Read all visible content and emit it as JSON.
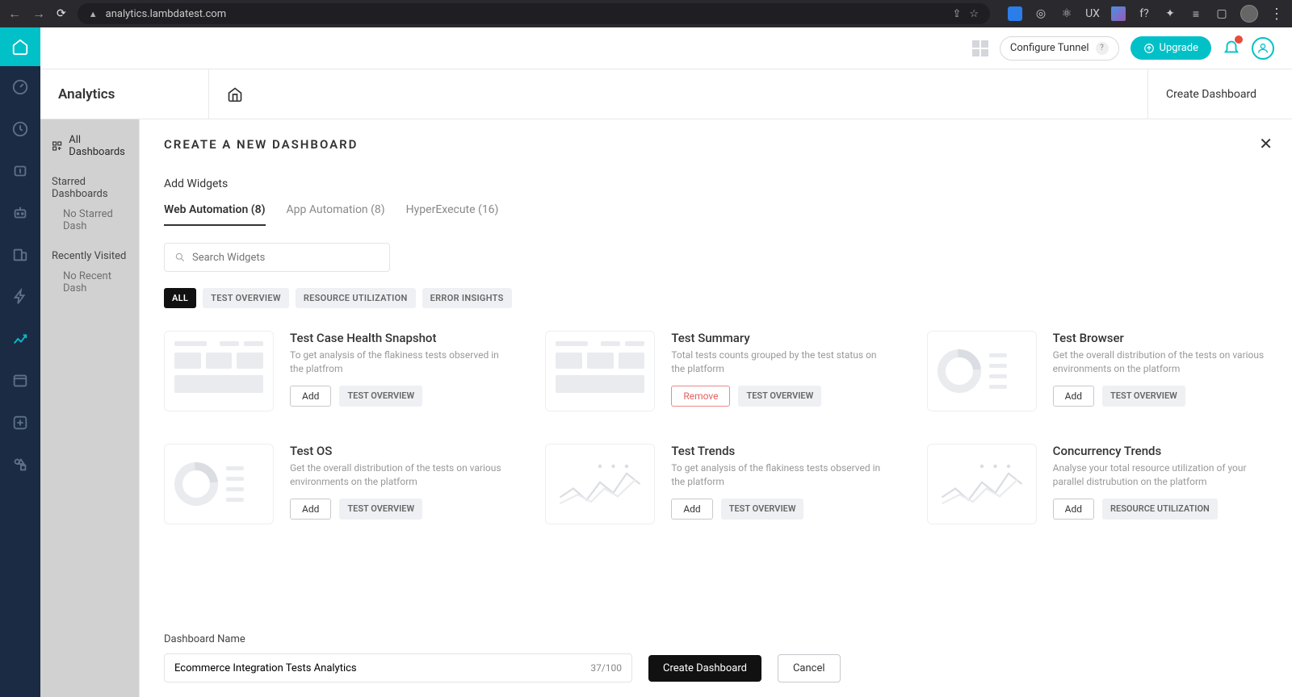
{
  "browser": {
    "url": "analytics.lambdatest.com"
  },
  "header": {
    "tunnel_label": "Configure Tunnel",
    "upgrade_label": "Upgrade"
  },
  "subheader": {
    "title": "Analytics",
    "create_link": "Create Dashboard"
  },
  "sidebar": {
    "all_dashboards": "All Dashboards",
    "starred_heading": "Starred Dashboards",
    "starred_empty": "No Starred Dash",
    "recent_heading": "Recently Visited",
    "recent_empty": "No Recent Dash"
  },
  "panel": {
    "title": "CREATE A NEW DASHBOARD",
    "add_widgets_label": "Add Widgets",
    "tabs": [
      {
        "label": "Web Automation (8)",
        "active": true
      },
      {
        "label": "App Automation (8)",
        "active": false
      },
      {
        "label": "HyperExecute (16)",
        "active": false
      }
    ],
    "search_placeholder": "Search Widgets",
    "filters": [
      {
        "label": "ALL",
        "active": true
      },
      {
        "label": "TEST OVERVIEW",
        "active": false
      },
      {
        "label": "RESOURCE UTILIZATION",
        "active": false
      },
      {
        "label": "ERROR INSIGHTS",
        "active": false
      }
    ],
    "widgets": [
      {
        "title": "Test Case Health Snapshot",
        "desc": "To get analysis of the flakiness tests observed in the platfrom",
        "action": "Add",
        "tag": "TEST OVERVIEW",
        "thumb": "skeleton"
      },
      {
        "title": "Test Summary",
        "desc": "Total tests counts grouped by the test status on the platform",
        "action": "Remove",
        "tag": "TEST OVERVIEW",
        "thumb": "skeleton"
      },
      {
        "title": "Test Browser",
        "desc": "Get the overall distribution of the tests on various environments on the platform",
        "action": "Add",
        "tag": "TEST OVERVIEW",
        "thumb": "donut"
      },
      {
        "title": "Test OS",
        "desc": "Get the overall distribution of the tests on various environments on the platform",
        "action": "Add",
        "tag": "TEST OVERVIEW",
        "thumb": "donut"
      },
      {
        "title": "Test Trends",
        "desc": "To get analysis of the flakiness tests observed in the platform",
        "action": "Add",
        "tag": "TEST OVERVIEW",
        "thumb": "trend"
      },
      {
        "title": "Concurrency Trends",
        "desc": "Analyse your total resource utilization of your parallel distrubution on the platform",
        "action": "Add",
        "tag": "RESOURCE UTILIZATION",
        "thumb": "trend"
      }
    ],
    "dashboard_name_label": "Dashboard Name",
    "dashboard_name_value": "Ecommerce Integration Tests Analytics",
    "dashboard_name_counter": "37/100",
    "create_btn": "Create Dashboard",
    "cancel_btn": "Cancel"
  }
}
